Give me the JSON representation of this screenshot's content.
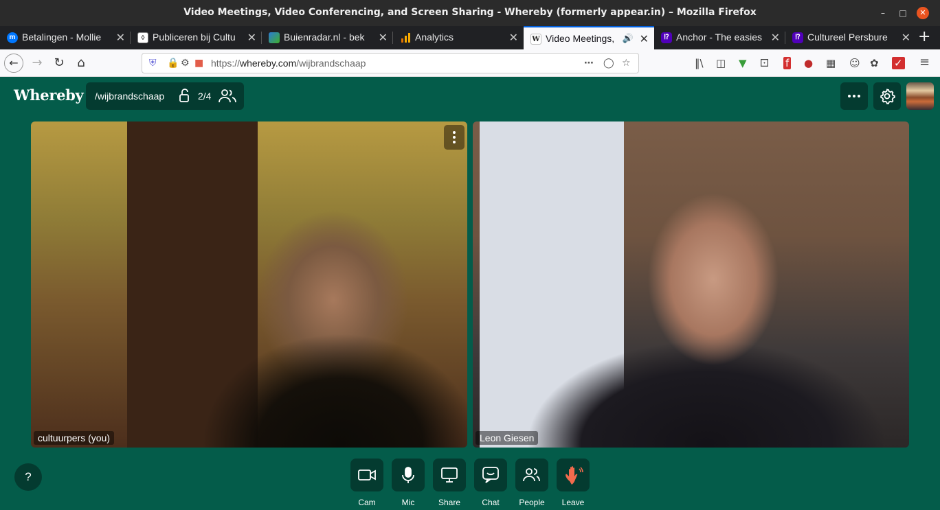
{
  "window": {
    "title": "Video Meetings, Video Conferencing, and Screen Sharing - Whereby (formerly appear.in) – Mozilla Firefox"
  },
  "tabs": [
    {
      "label": "Betalingen - Mollie",
      "favicon": "mollie-icon",
      "color": "#0077ff"
    },
    {
      "label": "Publiceren bij Cultu",
      "favicon": "wordpress-icon",
      "color": "#555555"
    },
    {
      "label": "Buienradar.nl - bek",
      "favicon": "buienradar-icon",
      "color": "#2b7bd6"
    },
    {
      "label": "Analytics",
      "favicon": "analytics-icon",
      "color": "#f9ab00"
    },
    {
      "label": "Video Meetings,",
      "favicon": "whereby-icon",
      "color": "#222222"
    },
    {
      "label": "Anchor - The easies",
      "favicon": "anchor-icon",
      "color": "#5000b9"
    },
    {
      "label": "Cultureel Persbure",
      "favicon": "anchor-icon",
      "color": "#5000b9"
    }
  ],
  "navbar": {
    "url_prefix": "https://",
    "url_domain": "whereby.com",
    "url_path": "/wijbrandschaap"
  },
  "app": {
    "logo": "Whereby",
    "room_name": "/wijbrandschaap",
    "participant_count": "2/4"
  },
  "participants": [
    {
      "name": "cultuurpers (you)"
    },
    {
      "name": "Leon Giesen"
    }
  ],
  "help_label": "?",
  "controls": [
    {
      "label": "Cam",
      "icon": "camera-icon"
    },
    {
      "label": "Mic",
      "icon": "microphone-icon"
    },
    {
      "label": "Share",
      "icon": "screen-share-icon"
    },
    {
      "label": "Chat",
      "icon": "chat-icon"
    },
    {
      "label": "People",
      "icon": "people-icon"
    },
    {
      "label": "Leave",
      "icon": "wave-hand-icon"
    }
  ],
  "colors": {
    "app_bg": "#045c4a",
    "button_bg": "#043b30",
    "leave_accent": "#f26b4d",
    "firefox_accent": "#0060df"
  }
}
